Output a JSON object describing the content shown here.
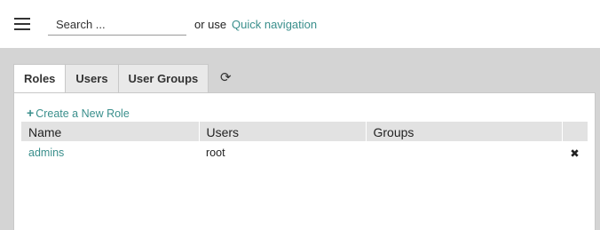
{
  "header": {
    "search_placeholder": "Search ...",
    "or_use": "or use",
    "quick_navigation": "Quick navigation"
  },
  "tabs": [
    {
      "label": "Roles",
      "active": true
    },
    {
      "label": "Users",
      "active": false
    },
    {
      "label": "User Groups",
      "active": false
    }
  ],
  "refresh_icon": "⟳",
  "panel": {
    "create_plus": "+",
    "create_label": "Create a New Role"
  },
  "table": {
    "columns": [
      "Name",
      "Users",
      "Groups",
      ""
    ],
    "rows": [
      {
        "name": "admins",
        "users": "root",
        "groups": "",
        "delete_icon": "✖"
      }
    ]
  },
  "colors": {
    "accent": "#3a8f8c",
    "content_bg": "#d4d4d4",
    "header_bg": "#e2e2e2"
  },
  "icons": [
    "menu-icon",
    "refresh-icon",
    "plus-icon",
    "delete-icon"
  ]
}
